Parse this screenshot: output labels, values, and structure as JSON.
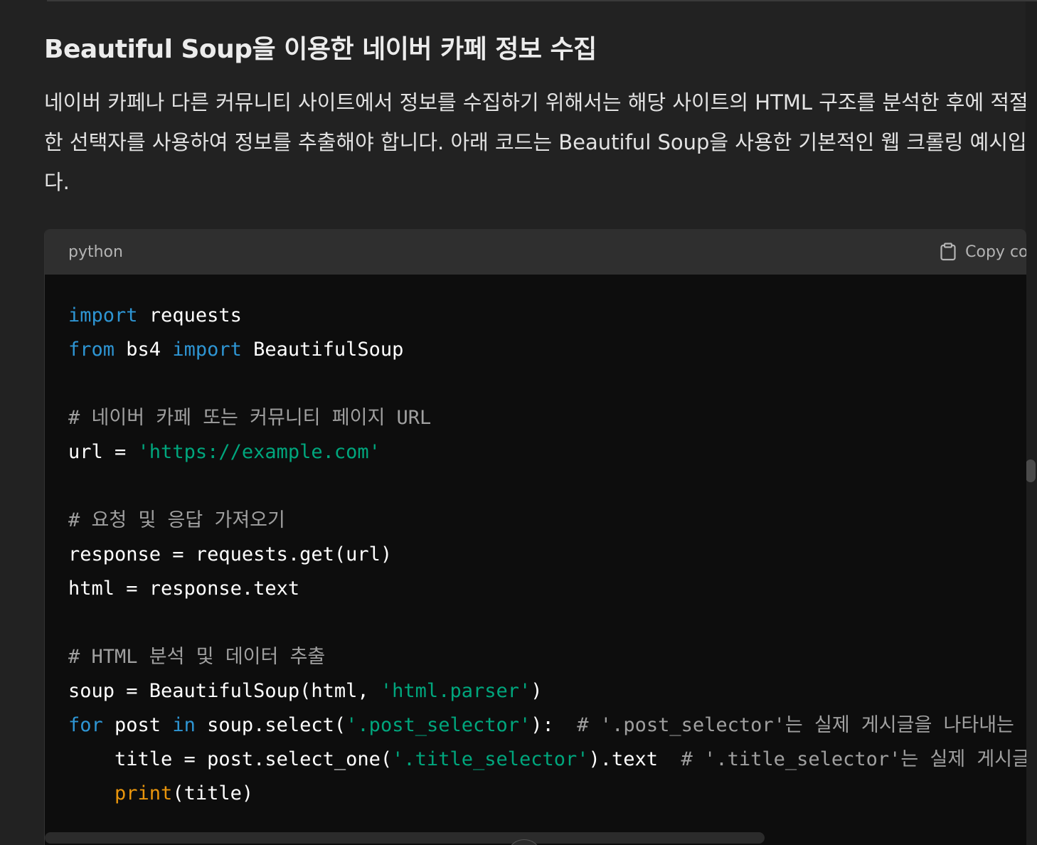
{
  "heading": "Beautiful Soup을 이용한 네이버 카페 정보 수집",
  "paragraph_lines": [
    "네이버 카페나 다른 커뮤니티 사이트에서 정보를 수집하기 위해서는 해당 사이트의 HTML 구조를 분석한 후에 적절",
    "한 선택자를 사용하여 정보를 추출해야 합니다. 아래 코드는 Beautiful Soup을 사용한 기본적인 웹 크롤링 예시입니",
    "다."
  ],
  "code_block": {
    "language": "python",
    "copy_label": "Copy code",
    "lines": [
      [
        {
          "t": "kw",
          "v": "import"
        },
        {
          "t": "plain",
          "v": " requests"
        }
      ],
      [
        {
          "t": "kw",
          "v": "from"
        },
        {
          "t": "plain",
          "v": " bs4 "
        },
        {
          "t": "kw",
          "v": "import"
        },
        {
          "t": "plain",
          "v": " BeautifulSoup"
        }
      ],
      [],
      [
        {
          "t": "cm",
          "v": "# 네이버 카페 또는 커뮤니티 페이지 URL"
        }
      ],
      [
        {
          "t": "plain",
          "v": "url = "
        },
        {
          "t": "str",
          "v": "'https://example.com'"
        }
      ],
      [],
      [
        {
          "t": "cm",
          "v": "# 요청 및 응답 가져오기"
        }
      ],
      [
        {
          "t": "plain",
          "v": "response = requests.get(url)"
        }
      ],
      [
        {
          "t": "plain",
          "v": "html = response.text"
        }
      ],
      [],
      [
        {
          "t": "cm",
          "v": "# HTML 분석 및 데이터 추출"
        }
      ],
      [
        {
          "t": "plain",
          "v": "soup = BeautifulSoup(html, "
        },
        {
          "t": "str",
          "v": "'html.parser'"
        },
        {
          "t": "plain",
          "v": ")"
        }
      ],
      [
        {
          "t": "kw",
          "v": "for"
        },
        {
          "t": "plain",
          "v": " post "
        },
        {
          "t": "kw",
          "v": "in"
        },
        {
          "t": "plain",
          "v": " soup.select("
        },
        {
          "t": "str",
          "v": "'.post_selector'"
        },
        {
          "t": "plain",
          "v": "):  "
        },
        {
          "t": "cm",
          "v": "# '.post_selector'는 실제 게시글을 나타내는 선택자로 변경해야 합니다"
        }
      ],
      [
        {
          "t": "plain",
          "v": "    title = post.select_one("
        },
        {
          "t": "str",
          "v": "'.title_selector'"
        },
        {
          "t": "plain",
          "v": ").text  "
        },
        {
          "t": "cm",
          "v": "# '.title_selector'는 실제 게시글 제목을 나타내는 선택자로 변경해야 합니다"
        }
      ],
      [
        {
          "t": "plain",
          "v": "    "
        },
        {
          "t": "bi",
          "v": "print"
        },
        {
          "t": "plain",
          "v": "(title)"
        }
      ]
    ]
  },
  "colors": {
    "keyword": "#2e95d3",
    "string": "#00a67d",
    "comment": "#a0a0a0",
    "builtin": "#e9950c",
    "background": "#222222",
    "code_background": "#0d0d0d"
  },
  "icons": {
    "copy": "clipboard-icon"
  }
}
